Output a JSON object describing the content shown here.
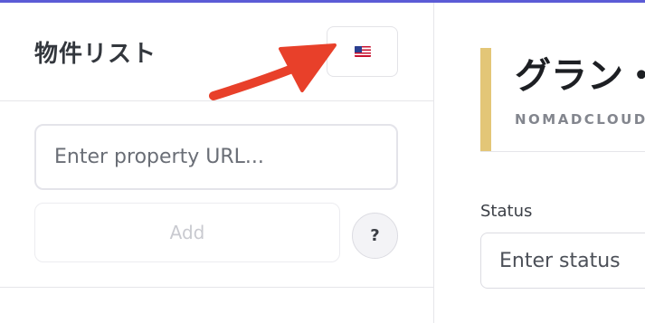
{
  "list_panel": {
    "title": "物件リスト",
    "language_icon": "us-flag-icon",
    "url_input": {
      "placeholder": "Enter property URL...",
      "value": ""
    },
    "add_label": "Add",
    "help_label": "?"
  },
  "detail_panel": {
    "title": "グラン・",
    "subtitle": "NOMADCLOUD",
    "status_label": "Status",
    "status_input": {
      "placeholder": "Enter status",
      "value": ""
    }
  },
  "colors": {
    "top_accent": "#5b5bd6",
    "title_accent_bar": "#e3c677",
    "annotation_arrow": "#e8402a"
  }
}
